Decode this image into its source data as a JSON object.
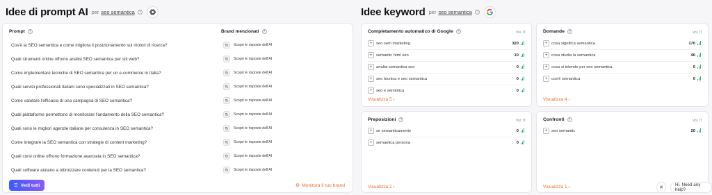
{
  "left": {
    "title": "Idee di prompt AI",
    "per": "per",
    "keyword": "seo semantica",
    "col_prompt": "Prompt",
    "col_brand": "Brand menzionati",
    "prompts": [
      "Cos'è la SEO semantica e come migliora il posizionamento sui motori di ricerca?",
      "Quali strumenti online offrono analisi SEO semantica per siti web?",
      "Come implementare tecniche di SEO semantica per un e-commerce in Italia?",
      "Quali servizi professionali italiani sono specializzati in SEO semantica?",
      "Come valutare l'efficacia di una campagna di SEO semantica?",
      "Quali piattaforme permettono di monitorare l'andamento della SEO semantica?",
      "Quali sono le migliori agenzie italiane per consulenza in SEO semantica?",
      "Come integrare la SEO semantica con strategie di content marketing?",
      "Quali corsi online offrono formazione avanzata in SEO semantica?",
      "Quali software aiutano a ottimizzare contenuti per la SEO semantica?"
    ],
    "brand_label": "Scopri le risposte dell'AI",
    "btn_vedi": "Vedi tutti",
    "link_monitora": "Monitora il tuo brand"
  },
  "right": {
    "title": "Idee keyword",
    "per": "per",
    "keyword": "seo semantica",
    "vol_label": "Vol. IT",
    "autocomplete": {
      "title": "Completamento automatico di Google",
      "rows": [
        {
          "kw": "seo sem marketing",
          "vol": "320"
        },
        {
          "kw": "semantic html seo",
          "vol": "10"
        },
        {
          "kw": "analisi semantica seo",
          "vol": "0"
        },
        {
          "kw": "seo tecnica e seo semantica",
          "vol": "0"
        },
        {
          "kw": "seo e semiotica",
          "vol": "0"
        }
      ],
      "more": "Visualizza 5"
    },
    "domande": {
      "title": "Domande",
      "rows": [
        {
          "kw": "cosa significa semantica",
          "vol": "170"
        },
        {
          "kw": "cosa studia la semantica",
          "vol": "40"
        },
        {
          "kw": "cosa si intende per seo semantica",
          "vol": "0"
        },
        {
          "kw": "cos'è semantica",
          "vol": "0"
        }
      ],
      "more": "Visualizza 4"
    },
    "preposizioni": {
      "title": "Preposizioni",
      "rows": [
        {
          "kw": "se semanticamente",
          "vol": "0"
        },
        {
          "kw": "semantica persona",
          "vol": "0"
        }
      ],
      "more": "Visualizza 2"
    },
    "confronti": {
      "title": "Confronti",
      "rows": [
        {
          "kw": "seo semantic",
          "vol": "20"
        }
      ],
      "more": "Visualizza 1"
    }
  },
  "chat": {
    "close": "✕",
    "text": "Hi. Need any help?"
  },
  "colors": {
    "accent_orange": "#e8692c",
    "button_gradient_start": "#3b5bfd",
    "button_gradient_end": "#8b5cf6",
    "trend_green": "#2bb673"
  }
}
